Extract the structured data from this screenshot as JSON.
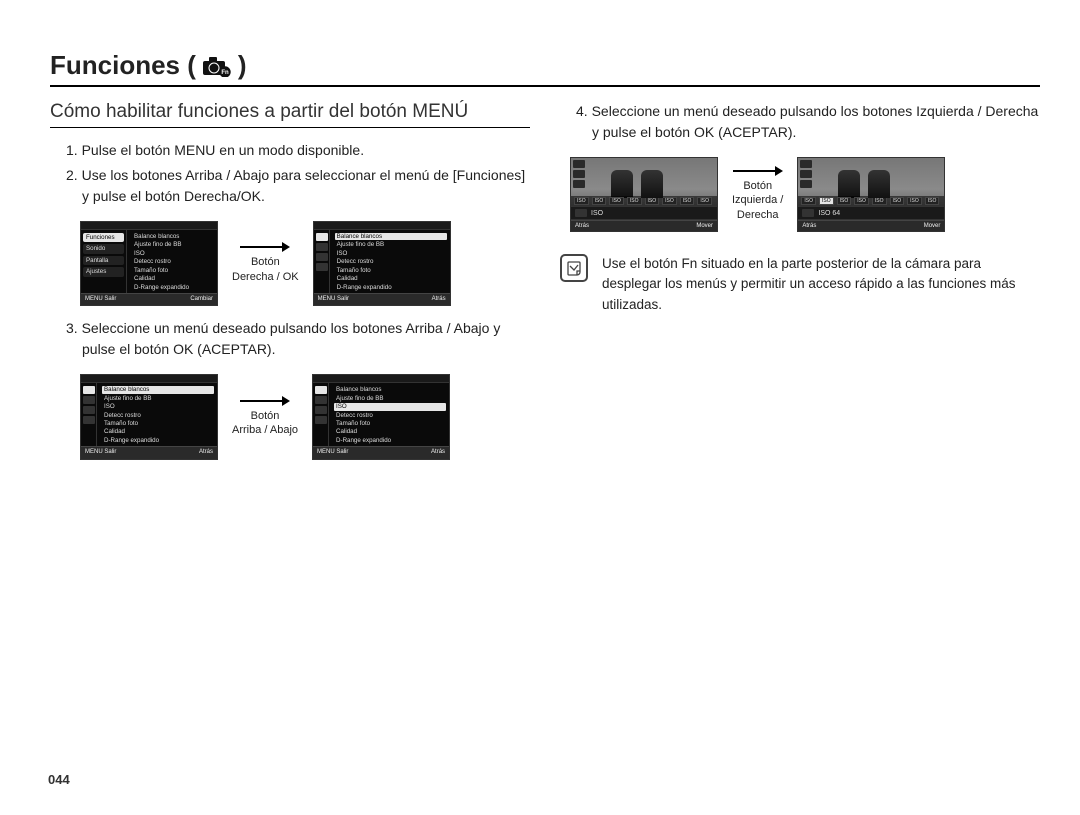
{
  "title_prefix": "Funciones (",
  "title_suffix": ")",
  "fn_label": "Fn",
  "subheading": "Cómo habilitar funciones a partir del botón MENÚ",
  "steps_left": [
    {
      "n": "1.",
      "t": "Pulse el botón MENU en un modo disponible."
    },
    {
      "n": "2.",
      "t": "Use los botones Arriba / Abajo para seleccionar el menú de [Funciones] y pulse el botón Derecha/OK."
    },
    {
      "n": "3.",
      "t": "Seleccione un menú deseado pulsando los botones Arriba / Abajo y pulse el botón OK (ACEPTAR)."
    }
  ],
  "steps_right": [
    {
      "n": "4.",
      "t": "Seleccione un menú deseado pulsando los botones Izquierda / Derecha y pulse el botón OK (ACEPTAR)."
    }
  ],
  "arrows": {
    "right_ok": "Botón\nDerecha / OK",
    "up_down": "Botón\nArriba / Abajo",
    "left_right": "Botón\nIzquierda /\nDerecha"
  },
  "menu": {
    "side_items": [
      "Funciones",
      "Sonido",
      "Pantalla",
      "Ajustes"
    ],
    "list_items": [
      "Balance blancos",
      "Ajuste fino de BB",
      "ISO",
      "Detecc rostro",
      "Tamaño foto",
      "Calidad",
      "D-Range expandido"
    ],
    "footer": {
      "left": "MENU  Salir",
      "right": "Cambiar",
      "right_b": "Atrás",
      "right_c": "Mover"
    }
  },
  "iso_values": [
    "ISO",
    "ISO",
    "ISO",
    "ISO",
    "ISO",
    "ISO",
    "ISO",
    "ISO"
  ],
  "iso_label_a": "ISO",
  "iso_label_b": "ISO 64",
  "note": "Use el botón Fn situado en la parte posterior de la cámara para desplegar los menús y permitir un acceso rápido a las funciones más utilizadas.",
  "page_number": "044",
  "chart_data": {
    "type": "table",
    "title": "Sequence of on-camera menu screens illustrating navigation with Direction/OK buttons",
    "screens": [
      {
        "step": 1,
        "highlighted_section": "Funciones (sidebar)",
        "visible_list_selection": null,
        "footer_right": "Cambiar"
      },
      {
        "step": 2,
        "highlighted_section": "menu list",
        "visible_list_selection": "Balance blancos",
        "footer_right": "Atrás"
      },
      {
        "step": 3,
        "highlighted_section": "menu list",
        "visible_list_selection": "ISO",
        "footer_right": "Atrás"
      },
      {
        "step": 4,
        "highlighted_section": "ISO value strip",
        "visible_list_selection": "ISO options",
        "footer_right": "Mover"
      }
    ]
  }
}
